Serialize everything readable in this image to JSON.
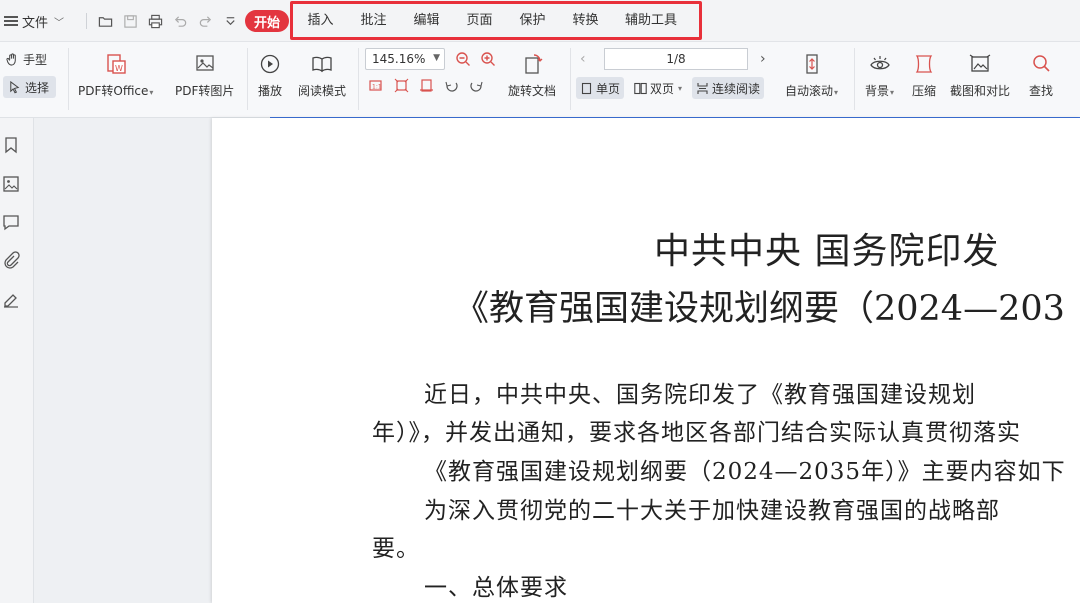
{
  "menu": {
    "file_label": "文件",
    "start_tab": "开始",
    "tabs": [
      "插入",
      "批注",
      "编辑",
      "页面",
      "保护",
      "转换",
      "辅助工具"
    ]
  },
  "quick_icons": [
    "open-folder-icon",
    "save-icon",
    "print-icon",
    "undo-icon",
    "redo-icon",
    "customize-icon"
  ],
  "ribbon": {
    "hand_label": "手型",
    "select_label": "选择",
    "pdf_to_office": "PDF转Office",
    "pdf_to_image": "PDF转图片",
    "play": "播放",
    "read_mode": "阅读模式",
    "zoom_value": "145.16%",
    "rotate_doc": "旋转文档",
    "page_indicator": "1/8",
    "single_page": "单页",
    "double_page": "双页",
    "continuous": "连续阅读",
    "auto_scroll": "自动滚动",
    "background": "背景",
    "compress": "压缩",
    "screenshot_compare": "截图和对比",
    "find": "查找"
  },
  "sidebar_icons": [
    "bookmark-icon",
    "thumbnail-icon",
    "comment-icon",
    "attachment-icon",
    "signature-icon"
  ],
  "document": {
    "title1": "中共中央 国务院印发",
    "title2": "《教育强国建设规划纲要（2024—203",
    "lines": [
      "近日，中共中央、国务院印发了《教育强国建设规划",
      "年）》，并发出通知，要求各地区各部门结合实际认真贯彻落实",
      "《教育强国建设规划纲要（2024—2035年）》主要内容如下",
      "为深入贯彻党的二十大关于加快建设教育强国的战略部",
      "要。",
      "一、总体要求"
    ]
  },
  "colors": {
    "accent_red": "#e3353f",
    "highlight_border": "#e8303a",
    "page_line_blue": "#3b6fd6"
  }
}
